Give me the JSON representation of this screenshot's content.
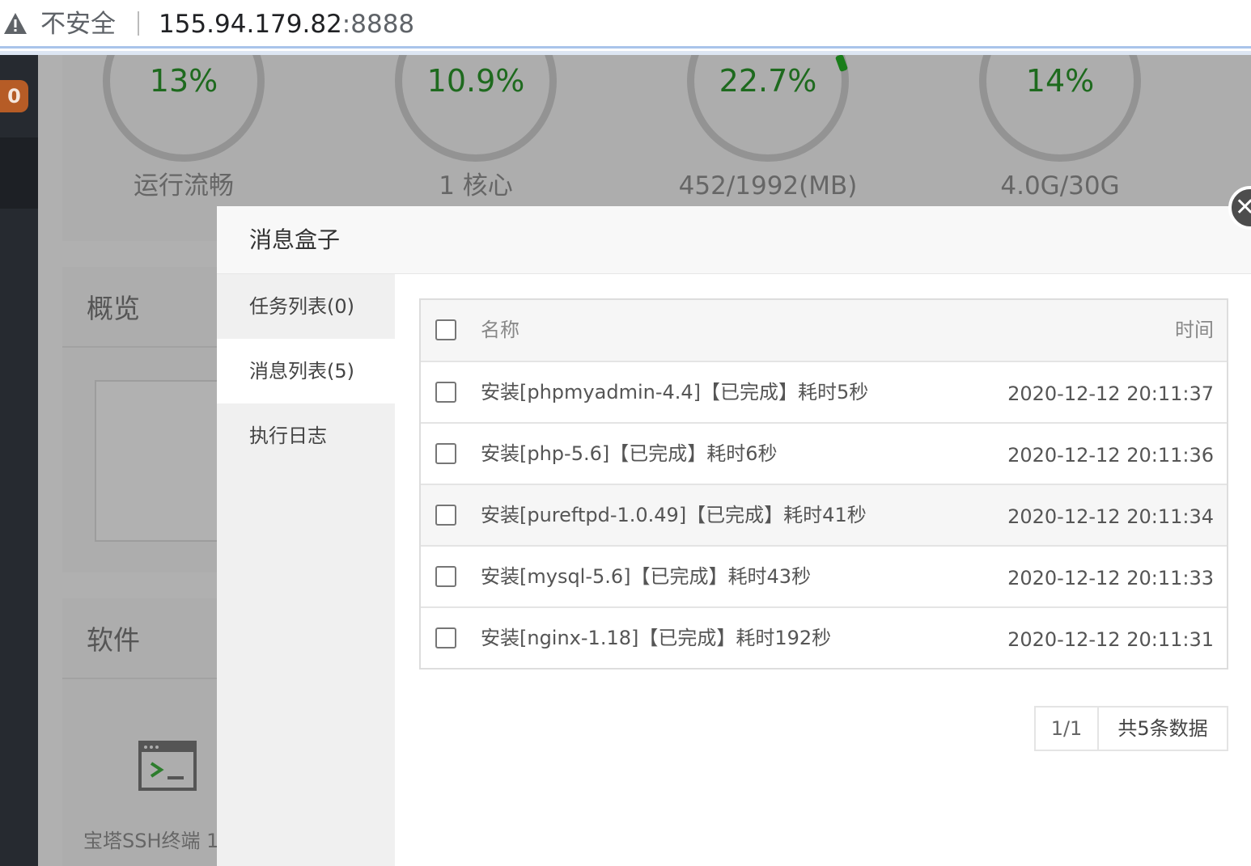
{
  "address_bar": {
    "security_label": "不安全",
    "host": "155.94.179.82",
    "port": ":8888"
  },
  "sidebar": {
    "badge_count": "0"
  },
  "stats": [
    {
      "value": "13%",
      "label": "运行流畅"
    },
    {
      "value": "10.9%",
      "label": "1 核心"
    },
    {
      "value": "22.7%",
      "label": "452/1992(MB)"
    },
    {
      "value": "14%",
      "label": "4.0G/30G"
    }
  ],
  "sections": {
    "overview_title": "概览",
    "software_title": "软件",
    "ssh_label": "宝塔SSH终端 1"
  },
  "modal": {
    "title": "消息盒子",
    "nav": [
      {
        "label": "任务列表(0)"
      },
      {
        "label": "消息列表(5)"
      },
      {
        "label": "执行日志"
      }
    ],
    "table": {
      "headers": {
        "name": "名称",
        "time": "时间"
      },
      "rows": [
        {
          "name": "安装[phpmyadmin-4.4]【已完成】耗时5秒",
          "time": "2020-12-12 20:11:37"
        },
        {
          "name": "安装[php-5.6]【已完成】耗时6秒",
          "time": "2020-12-12 20:11:36"
        },
        {
          "name": "安装[pureftpd-1.0.49]【已完成】耗时41秒",
          "time": "2020-12-12 20:11:34"
        },
        {
          "name": "安装[mysql-5.6]【已完成】耗时43秒",
          "time": "2020-12-12 20:11:33"
        },
        {
          "name": "安装[nginx-1.18]【已完成】耗时192秒",
          "time": "2020-12-12 20:11:31"
        }
      ]
    },
    "pager": {
      "page": "1/1",
      "total": "共5条数据"
    },
    "close_glyph": "✕"
  }
}
